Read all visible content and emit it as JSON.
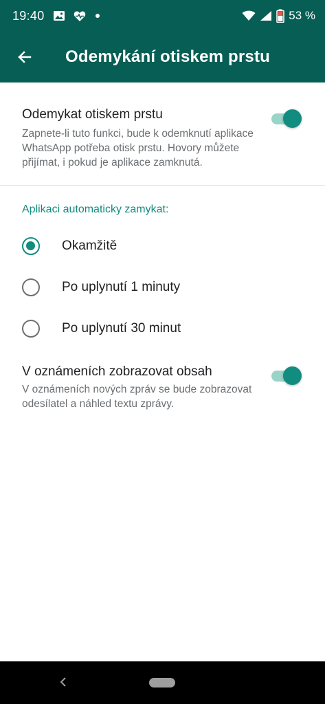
{
  "status_bar": {
    "time": "19:40",
    "battery": "53 %",
    "left_icons": [
      "image-icon",
      "heart-pulse-icon",
      "dot-icon"
    ],
    "right_icons": [
      "wifi-icon",
      "signal-icon",
      "battery-icon"
    ]
  },
  "app_bar": {
    "title": "Odemykání otiskem prstu",
    "back_icon": "arrow-left-icon"
  },
  "fingerprint_setting": {
    "title": "Odemykat otiskem prstu",
    "description": "Zapnete-li tuto funkci, bude k odemknutí aplikace WhatsApp potřeba otisk prstu. Hovory můžete přijímat, i pokud je aplikace zamknutá.",
    "enabled": true
  },
  "auto_lock": {
    "header": "Aplikaci automaticky zamykat:",
    "options": [
      {
        "label": "Okamžitě",
        "selected": true
      },
      {
        "label": "Po uplynutí 1 minuty",
        "selected": false
      },
      {
        "label": "Po uplynutí 30 minut",
        "selected": false
      }
    ]
  },
  "notification_setting": {
    "title": "V oznámeních zobrazovat obsah",
    "description": "V oznámeních nových zpráv se bude zobrazovat odesílatel a náhled textu zprávy.",
    "enabled": true
  },
  "colors": {
    "header": "#075e54",
    "accent": "#128c7e",
    "toggle_track": "#9ad3c8"
  }
}
